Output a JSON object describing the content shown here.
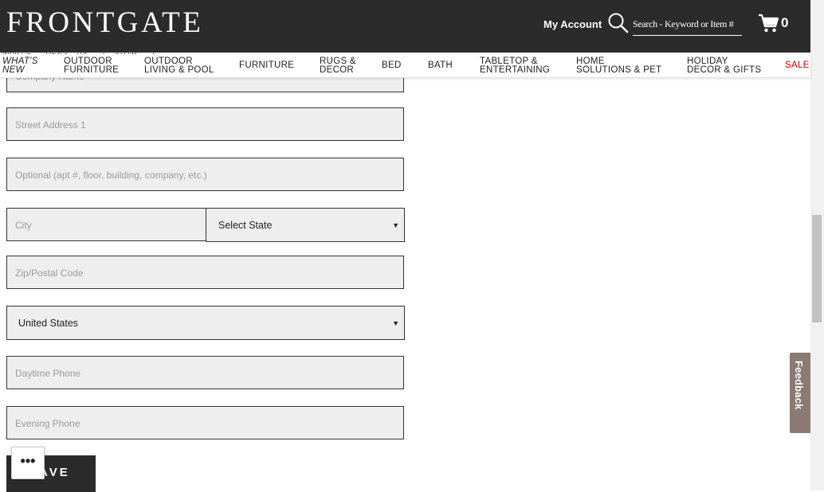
{
  "header": {
    "logo": "FRONTGATE",
    "my_account": "My Account",
    "search_placeholder": "Search - Keyword or Item #",
    "cart_count": "0",
    "breadcrumb_peek": "W097 5 ... DEV3 · UA ... 1 · AUTH ... 1"
  },
  "nav": {
    "items": [
      {
        "label": "WHAT'S\nNEW"
      },
      {
        "label": "OUTDOOR\nFURNITURE"
      },
      {
        "label": "OUTDOOR\nLIVING & POOL"
      },
      {
        "label": "FURNITURE"
      },
      {
        "label": "RUGS &\nDECOR"
      },
      {
        "label": "BED"
      },
      {
        "label": "BATH"
      },
      {
        "label": "TABLETOP &\nENTERTAINING"
      },
      {
        "label": "HOME\nSOLUTIONS & PET"
      },
      {
        "label": "HOLIDAY\nDECOR & GIFTS"
      },
      {
        "label": "SALE"
      }
    ],
    "sale_color": "#cc0000"
  },
  "form": {
    "company_placeholder": "Company Name",
    "street1_placeholder": "Street Address 1",
    "street2_placeholder": "Optional (apt #, floor, building, company, etc.)",
    "city_placeholder": "City",
    "state_selected": "Select State",
    "zip_placeholder": "Zip/Postal Code",
    "country_selected": "United States",
    "day_phone_placeholder": "Daytime Phone",
    "evening_phone_placeholder": "Evening Phone",
    "save_label": "SAVE"
  },
  "widgets": {
    "more_label": "•••",
    "feedback_label": "Feedback"
  }
}
